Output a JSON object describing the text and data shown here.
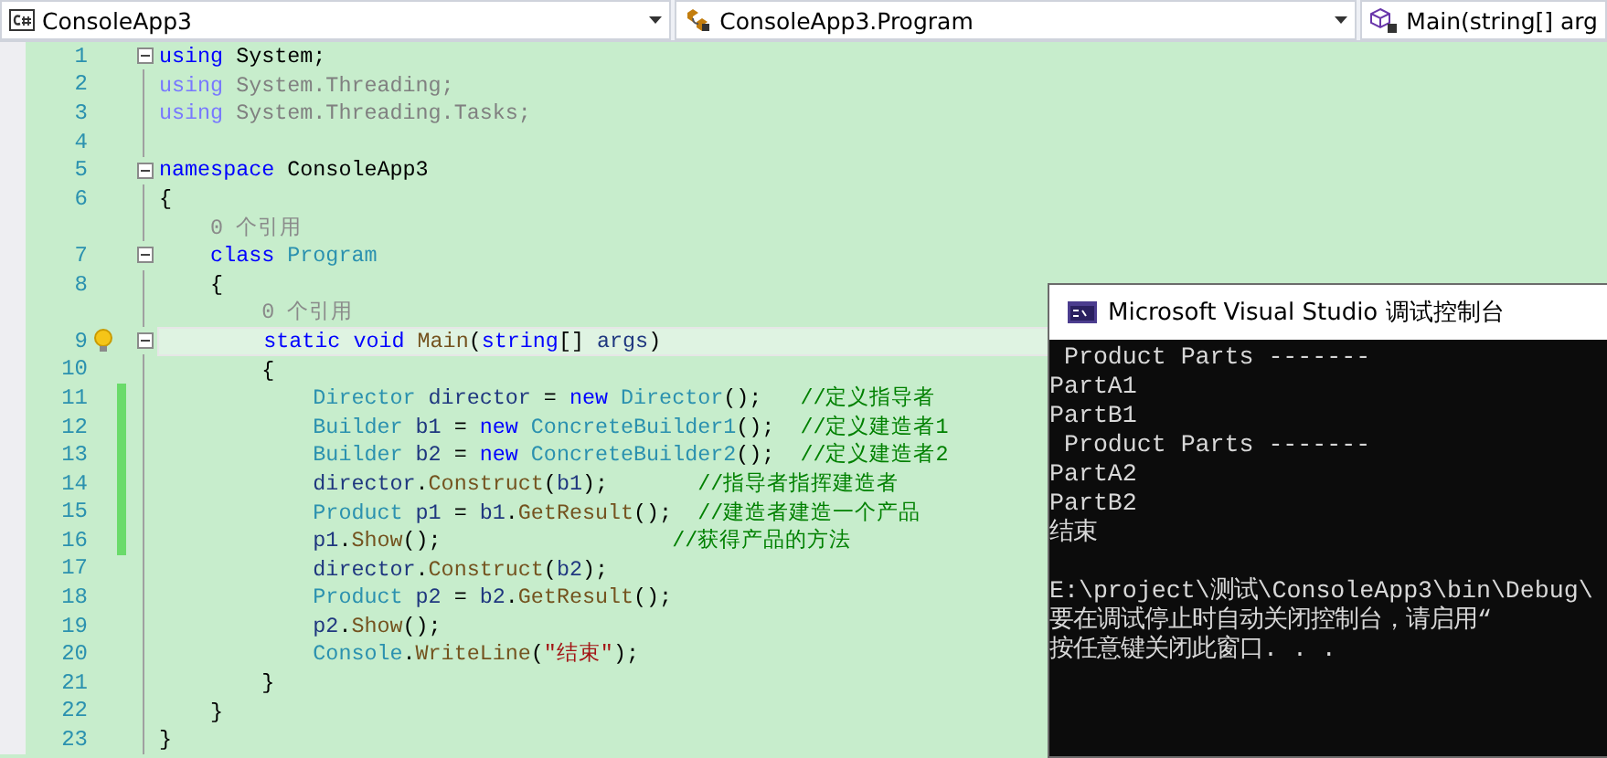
{
  "navigation_bar": [
    {
      "kind": "project",
      "text": "ConsoleApp3"
    },
    {
      "kind": "class",
      "text": "ConsoleApp3.Program"
    },
    {
      "kind": "method",
      "text": "Main(string[] arg"
    }
  ],
  "editor": {
    "lines": [
      {
        "kind": "code",
        "number": "1",
        "collapsible": true,
        "changed": false,
        "tokens": [
          {
            "kind": "keyword",
            "text": "using"
          },
          {
            "kind": "plain",
            "text": " System;"
          }
        ]
      },
      {
        "kind": "code",
        "number": "2",
        "collapsible": false,
        "changed": false,
        "tokens": [
          {
            "kind": "faded-keyword",
            "text": "using"
          },
          {
            "kind": "faded",
            "text": " System.Threading;"
          }
        ]
      },
      {
        "kind": "code",
        "number": "3",
        "collapsible": false,
        "changed": false,
        "tokens": [
          {
            "kind": "faded-keyword",
            "text": "using"
          },
          {
            "kind": "faded",
            "text": " System.Threading.Tasks;"
          }
        ]
      },
      {
        "kind": "code",
        "number": "4",
        "collapsible": false,
        "changed": false
      },
      {
        "kind": "code",
        "number": "5",
        "collapsible": true,
        "changed": false,
        "tokens": [
          {
            "kind": "keyword",
            "text": "namespace"
          },
          {
            "kind": "plain",
            "text": " ConsoleApp3"
          }
        ]
      },
      {
        "kind": "code",
        "number": "6",
        "collapsible": false,
        "changed": false,
        "tokens": [
          {
            "kind": "plain",
            "text": "{"
          }
        ]
      },
      {
        "kind": "codelens",
        "text": "    0 个引用"
      },
      {
        "kind": "code",
        "number": "7",
        "collapsible": true,
        "changed": false,
        "tokens": [
          {
            "kind": "keyword",
            "text": "    class"
          },
          {
            "kind": "type",
            "text": " Program"
          }
        ]
      },
      {
        "kind": "code",
        "number": "8",
        "collapsible": false,
        "changed": false,
        "tokens": [
          {
            "kind": "plain",
            "text": "    {"
          }
        ]
      },
      {
        "kind": "codelens",
        "text": "        0 个引用"
      },
      {
        "kind": "code",
        "number": "9",
        "collapsible": true,
        "changed": false,
        "lightbulb": true,
        "highlighted": true,
        "tokens": [
          {
            "kind": "keyword",
            "text": "        static void"
          },
          {
            "kind": "method",
            "text": " Main"
          },
          {
            "kind": "plain",
            "text": "("
          },
          {
            "kind": "keyword",
            "text": "string"
          },
          {
            "kind": "plain",
            "text": "[] "
          },
          {
            "kind": "variable",
            "text": "args"
          },
          {
            "kind": "plain",
            "text": ")"
          }
        ]
      },
      {
        "kind": "code",
        "number": "10",
        "collapsible": false,
        "changed": false,
        "tokens": [
          {
            "kind": "plain",
            "text": "        {"
          }
        ]
      },
      {
        "kind": "code",
        "number": "11",
        "collapsible": false,
        "changed": true,
        "tokens": [
          {
            "kind": "type",
            "text": "            Director"
          },
          {
            "kind": "variable",
            "text": " director"
          },
          {
            "kind": "plain",
            "text": " = "
          },
          {
            "kind": "keyword",
            "text": "new"
          },
          {
            "kind": "type",
            "text": " Director"
          },
          {
            "kind": "plain",
            "text": "();   "
          },
          {
            "kind": "comment",
            "text": "//定义指导者"
          }
        ]
      },
      {
        "kind": "code",
        "number": "12",
        "collapsible": false,
        "changed": true,
        "tokens": [
          {
            "kind": "type",
            "text": "            Builder"
          },
          {
            "kind": "variable",
            "text": " b1"
          },
          {
            "kind": "plain",
            "text": " = "
          },
          {
            "kind": "keyword",
            "text": "new"
          },
          {
            "kind": "type",
            "text": " ConcreteBuilder1"
          },
          {
            "kind": "plain",
            "text": "();  "
          },
          {
            "kind": "comment",
            "text": "//定义建造者1"
          }
        ]
      },
      {
        "kind": "code",
        "number": "13",
        "collapsible": false,
        "changed": true,
        "tokens": [
          {
            "kind": "type",
            "text": "            Builder"
          },
          {
            "kind": "variable",
            "text": " b2"
          },
          {
            "kind": "plain",
            "text": " = "
          },
          {
            "kind": "keyword",
            "text": "new"
          },
          {
            "kind": "type",
            "text": " ConcreteBuilder2"
          },
          {
            "kind": "plain",
            "text": "();  "
          },
          {
            "kind": "comment",
            "text": "//定义建造者2"
          }
        ]
      },
      {
        "kind": "code",
        "number": "14",
        "collapsible": false,
        "changed": true,
        "tokens": [
          {
            "kind": "variable",
            "text": "            director"
          },
          {
            "kind": "plain",
            "text": "."
          },
          {
            "kind": "method",
            "text": "Construct"
          },
          {
            "kind": "plain",
            "text": "("
          },
          {
            "kind": "variable",
            "text": "b1"
          },
          {
            "kind": "plain",
            "text": ");       "
          },
          {
            "kind": "comment",
            "text": "//指导者指挥建造者"
          }
        ]
      },
      {
        "kind": "code",
        "number": "15",
        "collapsible": false,
        "changed": true,
        "tokens": [
          {
            "kind": "type",
            "text": "            Product"
          },
          {
            "kind": "variable",
            "text": " p1"
          },
          {
            "kind": "plain",
            "text": " = "
          },
          {
            "kind": "variable",
            "text": "b1"
          },
          {
            "kind": "plain",
            "text": "."
          },
          {
            "kind": "method",
            "text": "GetResult"
          },
          {
            "kind": "plain",
            "text": "();  "
          },
          {
            "kind": "comment",
            "text": "//建造者建造一个产品"
          }
        ]
      },
      {
        "kind": "code",
        "number": "16",
        "collapsible": false,
        "changed": true,
        "tokens": [
          {
            "kind": "variable",
            "text": "            p1"
          },
          {
            "kind": "plain",
            "text": "."
          },
          {
            "kind": "method",
            "text": "Show"
          },
          {
            "kind": "plain",
            "text": "();                  "
          },
          {
            "kind": "comment",
            "text": "//获得产品的方法"
          }
        ]
      },
      {
        "kind": "code",
        "number": "17",
        "collapsible": false,
        "changed": false,
        "tokens": [
          {
            "kind": "variable",
            "text": "            director"
          },
          {
            "kind": "plain",
            "text": "."
          },
          {
            "kind": "method",
            "text": "Construct"
          },
          {
            "kind": "plain",
            "text": "("
          },
          {
            "kind": "variable",
            "text": "b2"
          },
          {
            "kind": "plain",
            "text": ");"
          }
        ]
      },
      {
        "kind": "code",
        "number": "18",
        "collapsible": false,
        "changed": false,
        "tokens": [
          {
            "kind": "type",
            "text": "            Product"
          },
          {
            "kind": "variable",
            "text": " p2"
          },
          {
            "kind": "plain",
            "text": " = "
          },
          {
            "kind": "variable",
            "text": "b2"
          },
          {
            "kind": "plain",
            "text": "."
          },
          {
            "kind": "method",
            "text": "GetResult"
          },
          {
            "kind": "plain",
            "text": "();"
          }
        ]
      },
      {
        "kind": "code",
        "number": "19",
        "collapsible": false,
        "changed": false,
        "tokens": [
          {
            "kind": "variable",
            "text": "            p2"
          },
          {
            "kind": "plain",
            "text": "."
          },
          {
            "kind": "method",
            "text": "Show"
          },
          {
            "kind": "plain",
            "text": "();"
          }
        ]
      },
      {
        "kind": "code",
        "number": "20",
        "collapsible": false,
        "changed": false,
        "tokens": [
          {
            "kind": "type",
            "text": "            Console"
          },
          {
            "kind": "plain",
            "text": "."
          },
          {
            "kind": "method",
            "text": "WriteLine"
          },
          {
            "kind": "plain",
            "text": "("
          },
          {
            "kind": "string",
            "text": "\"结束\""
          },
          {
            "kind": "plain",
            "text": ");"
          }
        ]
      },
      {
        "kind": "code",
        "number": "21",
        "collapsible": false,
        "changed": false,
        "tokens": [
          {
            "kind": "plain",
            "text": "        }"
          }
        ]
      },
      {
        "kind": "code",
        "number": "22",
        "collapsible": false,
        "changed": false,
        "tokens": [
          {
            "kind": "plain",
            "text": "    }"
          }
        ]
      },
      {
        "kind": "code",
        "number": "23",
        "collapsible": false,
        "changed": false,
        "tokens": [
          {
            "kind": "plain",
            "text": "}"
          }
        ]
      }
    ]
  },
  "console_window": {
    "title": "Microsoft Visual Studio 调试控制台",
    "output_blocks": [
      [
        " Product Parts -------",
        "PartA1",
        "PartB1",
        " Product Parts -------",
        "PartA2",
        "PartB2",
        "结束"
      ],
      [
        "E:\\project\\测试\\ConsoleApp3\\bin\\Debug\\",
        "要在调试停止时自动关闭控制台，请启用“",
        "按任意键关闭此窗口. . ."
      ]
    ]
  }
}
